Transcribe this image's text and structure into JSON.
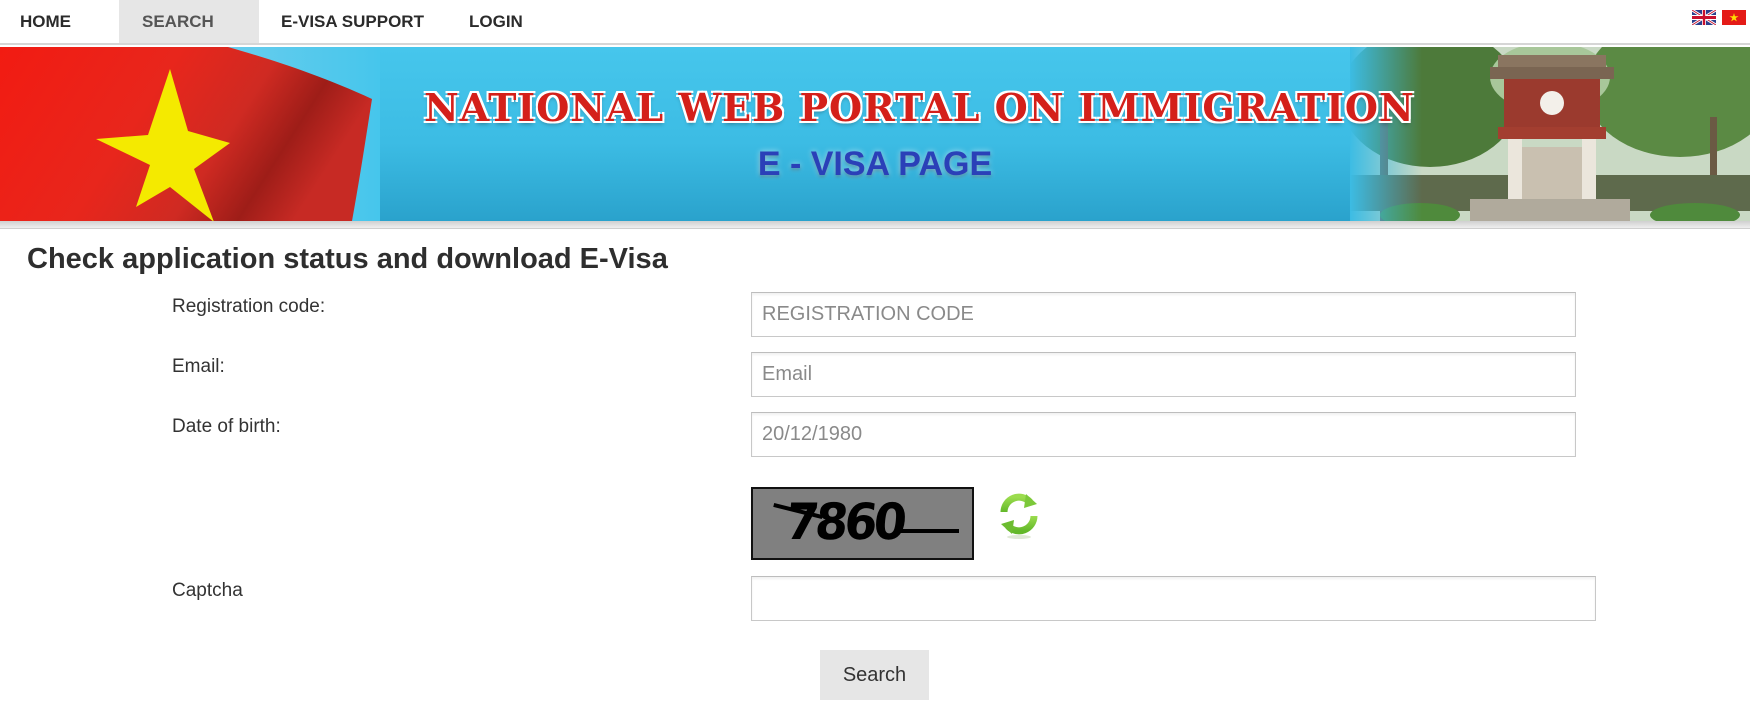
{
  "nav": {
    "items": [
      {
        "label": "HOME"
      },
      {
        "label": "SEARCH",
        "active": true
      },
      {
        "label": "E-VISA SUPPORT"
      },
      {
        "label": "LOGIN"
      }
    ],
    "languages": [
      {
        "icon": "uk-flag-icon",
        "label": "English"
      },
      {
        "icon": "vietnam-flag-icon",
        "label": "Vietnamese"
      }
    ]
  },
  "banner": {
    "title": "NATIONAL WEB PORTAL ON IMMIGRATION",
    "subtitle": "E - VISA PAGE",
    "colors": {
      "title": "#d4201a",
      "subtitle": "#2a40b8",
      "sky": "#3cbce4"
    }
  },
  "main": {
    "title": "Check application status and download E-Visa",
    "form": {
      "registration": {
        "label": "Registration code:",
        "placeholder": "REGISTRATION CODE",
        "value": ""
      },
      "email": {
        "label": "Email:",
        "placeholder": "Email",
        "value": ""
      },
      "dob": {
        "label": "Date of birth:",
        "placeholder": "20/12/1980",
        "value": ""
      },
      "captcha": {
        "label": "Captcha",
        "image_text": "7860",
        "refresh_icon": "refresh-icon",
        "value": ""
      },
      "submit_label": "Search"
    }
  }
}
